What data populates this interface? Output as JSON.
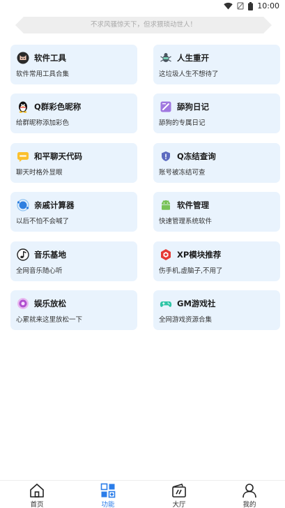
{
  "status_bar": {
    "time": "10:00"
  },
  "slogan": "不求风骚惊天下，但求猥琐动世人！",
  "cards": [
    {
      "title": "软件工具",
      "desc": "软件常用工具合集",
      "icon": "cat-icon"
    },
    {
      "title": "人生重开",
      "desc": "这垃圾人生不想待了",
      "icon": "bug-icon"
    },
    {
      "title": "Q群彩色昵称",
      "desc": "给群昵称添加彩色",
      "icon": "penguin-icon"
    },
    {
      "title": "舔狗日记",
      "desc": "舔狗的专属日记",
      "icon": "notebook-icon"
    },
    {
      "title": "和平聊天代码",
      "desc": "聊天时格外显眼",
      "icon": "chat-bubble-icon"
    },
    {
      "title": "Q冻结查询",
      "desc": "账号被冻结可查",
      "icon": "shield-icon"
    },
    {
      "title": "亲戚计算器",
      "desc": "以后不怕不会喊了",
      "icon": "orbit-icon"
    },
    {
      "title": "软件管理",
      "desc": "快速管理系统软件",
      "icon": "android-icon"
    },
    {
      "title": "音乐基地",
      "desc": "全网音乐随心听",
      "icon": "music-note-icon"
    },
    {
      "title": "XP模块推荐",
      "desc": "伤手机,虚脑子,不用了",
      "icon": "hexagon-icon"
    },
    {
      "title": "娱乐放松",
      "desc": "心累就来这里放松一下",
      "icon": "flower-icon"
    },
    {
      "title": "GM游戏社",
      "desc": "全网游戏资源合集",
      "icon": "gamepad-icon"
    }
  ],
  "nav": [
    {
      "label": "首页",
      "icon": "home-icon",
      "active": false
    },
    {
      "label": "功能",
      "icon": "grid-icon",
      "active": true
    },
    {
      "label": "大厅",
      "icon": "hall-icon",
      "active": false
    },
    {
      "label": "我的",
      "icon": "user-icon",
      "active": false
    }
  ],
  "colors": {
    "accent": "#2b7de9",
    "card_bg": "#e9f3fd"
  }
}
